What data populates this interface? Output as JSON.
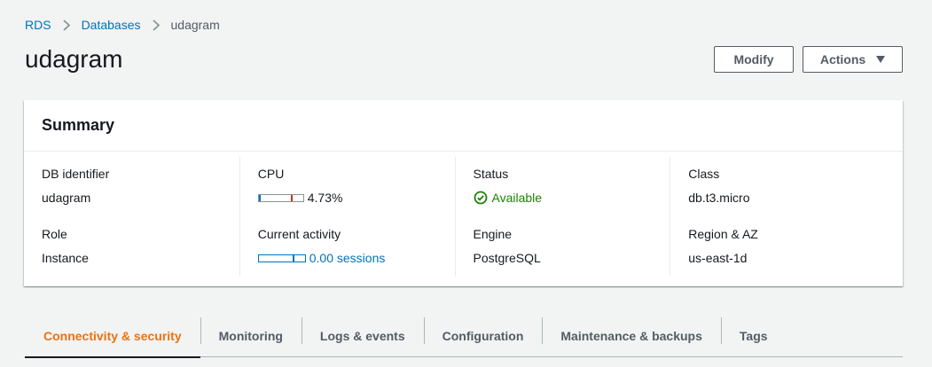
{
  "breadcrumb": {
    "items": [
      "RDS",
      "Databases"
    ],
    "current": "udagram"
  },
  "page": {
    "title": "udagram"
  },
  "buttons": {
    "modify": "Modify",
    "actions": "Actions"
  },
  "summary": {
    "title": "Summary",
    "db_identifier": {
      "label": "DB identifier",
      "value": "udagram"
    },
    "role": {
      "label": "Role",
      "value": "Instance"
    },
    "cpu": {
      "label": "CPU",
      "value": "4.73%",
      "percent": 4.73,
      "icon": "mini-usage-bar"
    },
    "current_activity": {
      "label": "Current activity",
      "value": "0.00 sessions",
      "sessions": 0.0,
      "icon": "mini-usage-bar"
    },
    "status": {
      "label": "Status",
      "value": "Available",
      "icon": "check-circle-icon",
      "color": "#1d8102"
    },
    "engine": {
      "label": "Engine",
      "value": "PostgreSQL"
    },
    "class": {
      "label": "Class",
      "value": "db.t3.micro"
    },
    "region_az": {
      "label": "Region & AZ",
      "value": "us-east-1d"
    }
  },
  "tabs": [
    {
      "label": "Connectivity & security",
      "active": true
    },
    {
      "label": "Monitoring",
      "active": false
    },
    {
      "label": "Logs & events",
      "active": false
    },
    {
      "label": "Configuration",
      "active": false
    },
    {
      "label": "Maintenance & backups",
      "active": false
    },
    {
      "label": "Tags",
      "active": false
    }
  ],
  "colors": {
    "link": "#0073bb",
    "active_tab": "#ec7211",
    "success": "#1d8102",
    "background": "#f2f3f3"
  }
}
